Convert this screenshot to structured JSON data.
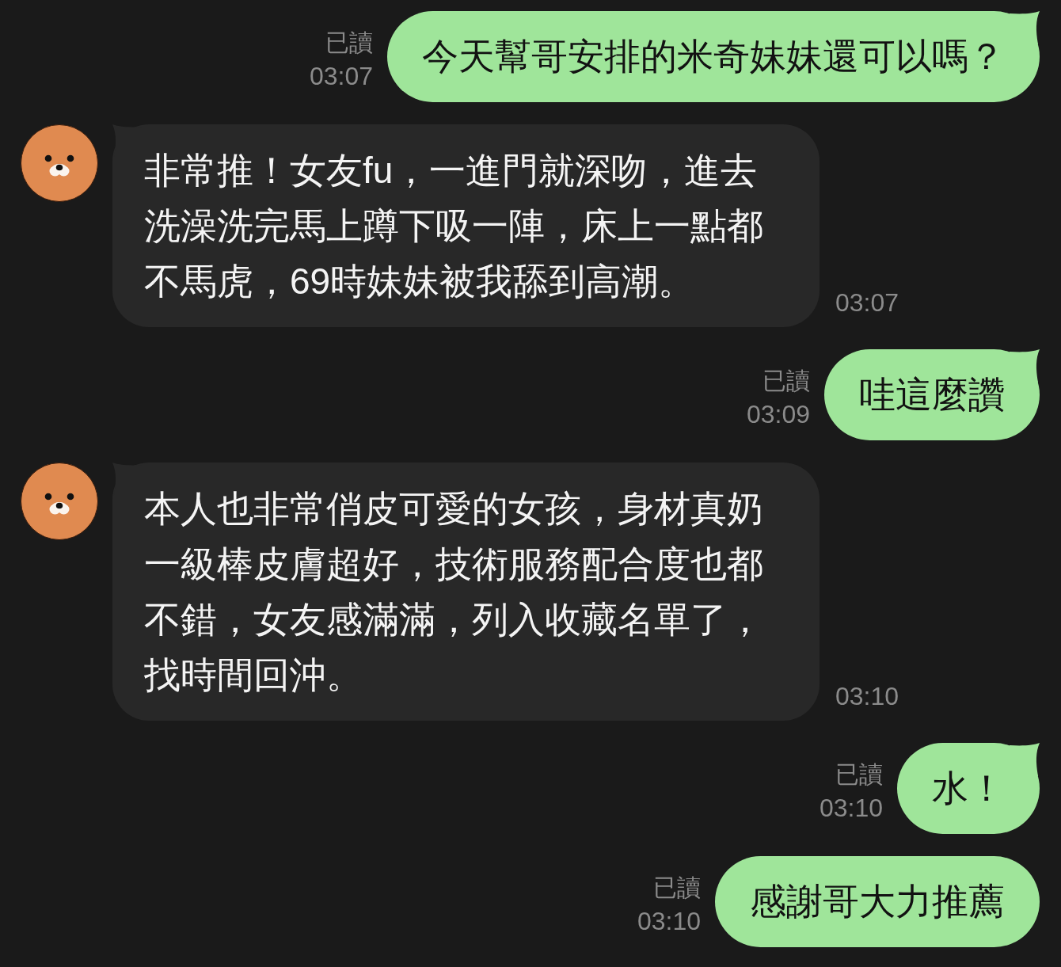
{
  "messages": [
    {
      "kind": "sent",
      "tail": true,
      "read_label": "已讀",
      "time": "03:07",
      "text": "今天幫哥安排的米奇妹妹還可以嗎？"
    },
    {
      "kind": "received",
      "tail": true,
      "text": "非常推！女友fu，一進門就深吻，進去洗澡洗完馬上蹲下吸一陣，床上一點都不馬虎，69時妹妹被我舔到高潮。",
      "time": "03:07"
    },
    {
      "kind": "sent",
      "tail": true,
      "read_label": "已讀",
      "time": "03:09",
      "text": "哇這麼讚"
    },
    {
      "kind": "received",
      "tail": true,
      "text": "本人也非常俏皮可愛的女孩，身材真奶一級棒皮膚超好，技術服務配合度也都不錯，女友感滿滿，列入收藏名單了，找時間回沖。",
      "time": "03:10"
    },
    {
      "kind": "sent",
      "tail": true,
      "read_label": "已讀",
      "time": "03:10",
      "text": "水！"
    },
    {
      "kind": "sent",
      "tail": false,
      "read_label": "已讀",
      "time": "03:10",
      "text": "感謝哥大力推薦"
    }
  ]
}
